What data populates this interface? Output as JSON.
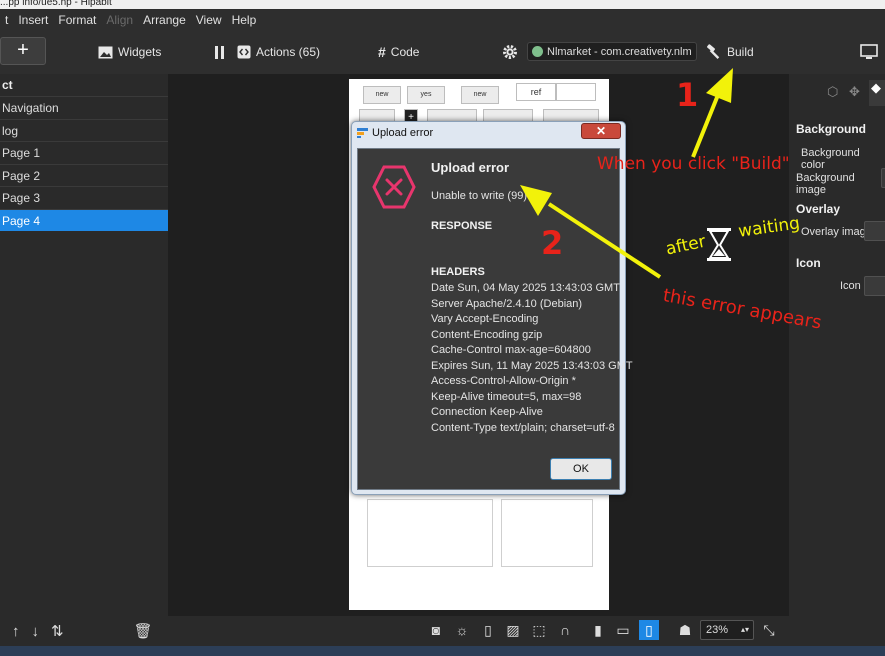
{
  "window": {
    "title": "...pp info/ue5.hp - Hipabit"
  },
  "menu": [
    "t",
    "Insert",
    "Format",
    "Align",
    "Arrange",
    "View",
    "Help"
  ],
  "toolbar": {
    "add_label": "+",
    "widgets_label": "Widgets",
    "actions_label": "Actions (65)",
    "code_label": "Code",
    "project_name": "Nlmarket - com.creativety.nlm",
    "build_label": "Build"
  },
  "left_panel": {
    "header": "ct",
    "items": [
      {
        "label": "Navigation",
        "selected": false
      },
      {
        "label": "log",
        "selected": false
      },
      {
        "label": "Page 1",
        "selected": false
      },
      {
        "label": "Page 2",
        "selected": false
      },
      {
        "label": "Page 3",
        "selected": false
      },
      {
        "label": "Page 4",
        "selected": true
      }
    ]
  },
  "phone_preview": {
    "buttons": [
      "new",
      "yes",
      "new",
      "ref"
    ]
  },
  "right_panel": {
    "background_title": "Background",
    "background_color": "Background color",
    "background_image": "Background image",
    "overlay_title": "Overlay",
    "overlay_image": "Overlay image",
    "icon_title": "Icon",
    "icon_label": "Icon"
  },
  "dialog": {
    "window_title": "Upload error",
    "close_label": "✕",
    "heading": "Upload error",
    "message": "Unable to write (99)",
    "response_label": "RESPONSE",
    "headers_label": "HEADERS",
    "header_lines": [
      "Date Sun, 04 May 2025 13:43:03 GMT",
      "Server Apache/2.4.10 (Debian)",
      "Vary Accept-Encoding",
      "Content-Encoding gzip",
      "Cache-Control max-age=604800",
      "Expires Sun, 11 May 2025 13:43:03 GMT",
      "Access-Control-Allow-Origin *",
      "Keep-Alive timeout=5, max=98",
      "Connection Keep-Alive",
      "Content-Type text/plain; charset=utf-8"
    ],
    "ok_label": "OK"
  },
  "bottom_bar": {
    "zoom": "23%"
  },
  "annotations": {
    "num1": "1",
    "num2": "2",
    "build_note": "When you click \"Build\"",
    "after": "after",
    "waiting": "waiting",
    "error_note": "this error appears"
  },
  "colors": {
    "accent": "#1e88e5",
    "annotation_yellow": "#f2f20a",
    "annotation_red": "#e8231a",
    "error_icon": "#e8356d"
  }
}
